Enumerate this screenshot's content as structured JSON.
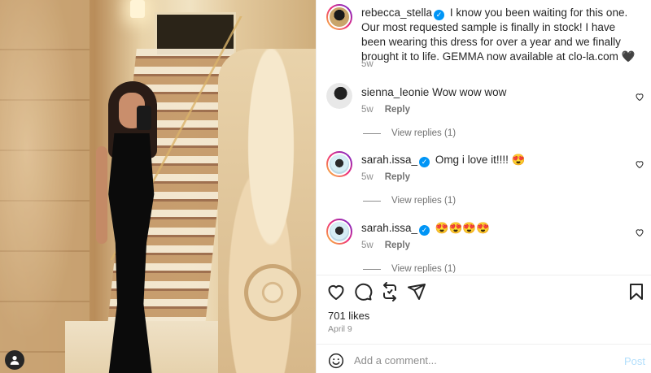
{
  "post": {
    "author": "rebecca_stella",
    "caption": "I know you been waiting for this one. Our most requested sample is finally in stock! I have been wearing this dress for over a year and we finally brought it to life. GEMMA now available at clo-la.com 🖤",
    "age": "5w"
  },
  "comments": [
    {
      "username": "sienna_leonie",
      "text": "Wow wow wow",
      "age": "5w",
      "reply_label": "Reply",
      "view_replies": "View replies (1)",
      "verified": false
    },
    {
      "username": "sarah.issa_",
      "text": "Omg i love it!!!! 😍",
      "age": "5w",
      "reply_label": "Reply",
      "view_replies": "View replies (1)",
      "verified": true
    },
    {
      "username": "sarah.issa_",
      "text": "😍😍😍😍",
      "age": "5w",
      "reply_label": "Reply",
      "view_replies": "View replies (1)",
      "verified": true
    }
  ],
  "stats": {
    "likes": "701 likes",
    "date": "April 9"
  },
  "add_comment": {
    "placeholder": "Add a comment...",
    "post_label": "Post"
  },
  "colors": {
    "accent": "#0095f6",
    "post_disabled": "#b2dffc",
    "muted": "#8e8e8e"
  },
  "icons": [
    "like-icon",
    "comment-icon",
    "share-icon",
    "send-icon",
    "bookmark-icon",
    "emoji-icon",
    "heart-icon",
    "user-icon",
    "verified-icon"
  ]
}
